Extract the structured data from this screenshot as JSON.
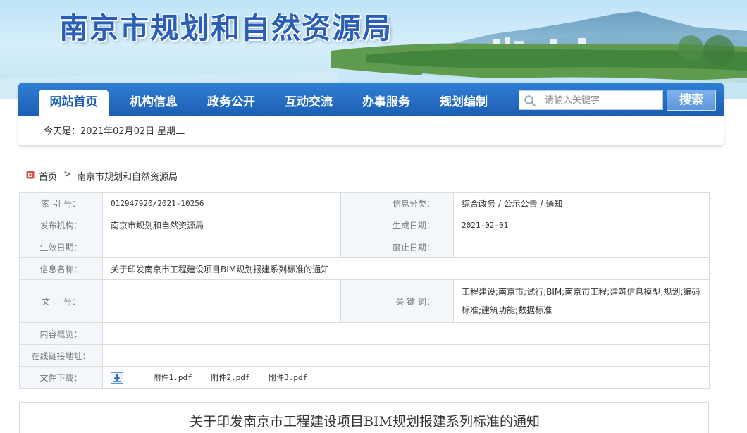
{
  "site": {
    "title": "南京市规划和自然资源局"
  },
  "nav": {
    "items": [
      "网站首页",
      "机构信息",
      "政务公开",
      "互动交流",
      "办事服务",
      "规划编制"
    ],
    "active_index": 0
  },
  "search": {
    "placeholder": "请输入关键字",
    "button_label": "搜索"
  },
  "date_line": "今天是：2021年02月02日 星期二",
  "breadcrumb": {
    "home": "首页",
    "separator": ">",
    "current": "南京市规划和自然资源局"
  },
  "info": {
    "index_label": "索 引 号：",
    "index_value": "012947920/2021-10256",
    "category_label": "信息分类：",
    "category_value": "综合政务 / 公示公告 / 通知",
    "publisher_label": "发布机构：",
    "publisher_value": "南京市规划和自然资源局",
    "created_label": "生成日期：",
    "created_value": "2021-02-01",
    "effective_label": "生效日期：",
    "effective_value": "",
    "expire_label": "废止日期：",
    "expire_value": "",
    "name_label": "信息名称：",
    "name_value": "关于印发南京市工程建设项目BIM规划报建系列标准的通知",
    "docno_label": "文     号：",
    "docno_value": "",
    "keywords_label": "关 键 词：",
    "keywords_value": "工程建设;南京市;试行;BIM;南京市工程;建筑信息模型;规划;编码标准;建筑功能;数据标准",
    "summary_label": "内容概览：",
    "summary_value": "",
    "link_label": "在线链接地址：",
    "link_value": "",
    "download_label": "文件下载：",
    "attachments": [
      "附件1.pdf",
      "附件2.pdf",
      "附件3.pdf"
    ]
  },
  "article": {
    "title": "关于印发南京市工程建设项目BIM规划报建系列标准的通知"
  },
  "colors": {
    "nav_blue": "#1d5fb5",
    "title_blue": "#2a5fb8",
    "label_bg": "#f3f6fa",
    "border": "#dcdcdc"
  },
  "icons": [
    "search-icon",
    "home-icon",
    "download-icon"
  ]
}
